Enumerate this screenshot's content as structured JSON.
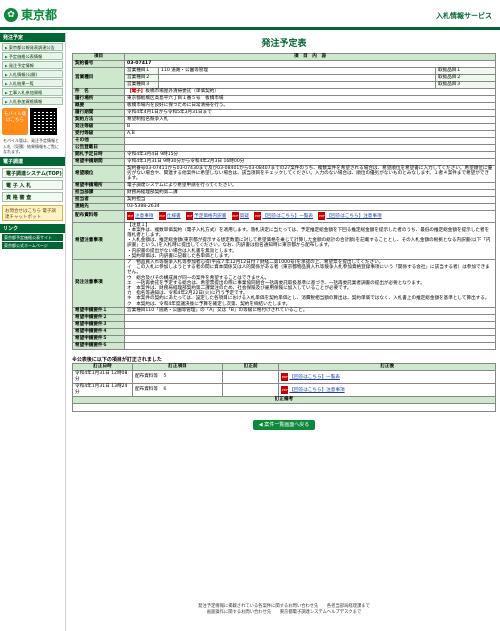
{
  "header": {
    "logo": "東京都",
    "site": "入札情報サービス"
  },
  "sidebar": {
    "section1": "発注予定",
    "links": [
      "東京都公報発表調達公告",
      "予定価格公表情報",
      "発注予定情報",
      "入札情報(公開)",
      "入札結果一覧",
      "工事入札参加資格",
      "入札参加資格情報"
    ],
    "mobile_label": "モバイル版 はこちら",
    "mobile_note": "モバイル版は、発注予定情報と入札（見積）結果情報をご覧になれます。",
    "section2": "電子調達",
    "big_links": [
      "電子調達システム(TOP)",
      "電 子 入 札",
      "資 格 審 査"
    ],
    "faq": "お問合せはこちら 電子調達チャットボット",
    "section3": "リンク",
    "ext_links": [
      "東京都予定価格公表サイト",
      "東京都公式ホームページ"
    ]
  },
  "page_title": "発注予定表",
  "cols": {
    "item": "項目",
    "content": "項　目　内　容"
  },
  "rows": {
    "contract_no_label": "契約番号",
    "contract_no": "03-07417",
    "kind_label": "営業種目",
    "kinds": [
      {
        "k": "営業種目１",
        "v": "110 道路・公園等管理",
        "c": "取扱品目１"
      },
      {
        "k": "営業種目２",
        "v": "",
        "c": "取扱品目２"
      },
      {
        "k": "営業種目３",
        "v": "",
        "c": "取扱品目３"
      }
    ],
    "name_label": "件　名",
    "name_tag": "【電子】",
    "name": "板橋市場屋外清掃委託（単価契約）",
    "place_label": "履行場所",
    "place": "東京都板橋区高島平六丁目１番５号　板橋市場",
    "summary_label": "概要",
    "summary": "板橋市場内を良好に保つために日常清掃を行う。",
    "period_label": "履行期間",
    "period": "令和4年4月1日から令和5年3月31日まで",
    "method_label": "契約方法",
    "method": "希望制指名競争入札",
    "grade_label": "発注等級",
    "grade": "B",
    "accept_label": "受付等級",
    "accept": "A,B",
    "other_label": "その他",
    "other": "",
    "publish_label": "公告登載日",
    "publish": "",
    "open_label": "開札予定日時",
    "open": "令和4年3月4日 9時15分",
    "apply_label": "希望申請期間",
    "apply": "令和4年1月31日 9時30分から令和4年2月3日 16時00分",
    "hope_label": "希望順位",
    "hope": "契約番号03-07411から03-07430まで及び03-08401から03-08407までの27案件のうち、複数案件を希望される場合は、希望順位を希望書に入力してください。希望順位に優劣がない場合や、関連する他案件に希望しない場合は、該当項目をチェックしてください。入力のない場合は、順位の優劣がないものとみなします。１者４案件まで希望ができます。",
    "sys_label": "希望申請場所",
    "sys": "電子調達システムにより希望申請を行ってください。",
    "dept_label": "担当部課",
    "dept": "財務局経理部契約第二課",
    "person_label": "担当者",
    "person": "契約担当",
    "tel_label": "連絡先",
    "tel": "03-5388-2634",
    "docs_label": "配布資料等",
    "docs": [
      "注意事項",
      "仕様書",
      "予定価格内訳書",
      "質疑",
      "【回答はこちら】一覧表",
      "【回答はこちら】注意事項"
    ],
    "notes_label": "希望注意事項",
    "notes": "【注意１】\n・本案件は、複数単価契約（電子入札方式）を適用します。落札決定に当たっては、予定推定総金額を下回る推定総金額を提示した者のうち、最低の推定総金額を提示した者を落札者とします。\n・入札金額は、推定総金額(東京都が提示する想定数量に対して希望価格を乗じて計算した金額の総計の合計額)を記載することとし、その入札金額の根拠となる内訳書(以下「内訳書」という。)を入札時に提出してください。なお、内訳書は指名通知時に東京都から配布します。\n・内訳書の提出がない場合は入札書を無効とします。\n・契約単価は、内訳書に記載した各単価とします。",
    "notes2_label": "発注注意事項",
    "notes2": "ア　物品買入れ等競争入札等参加者心得(平成７年12月12日付７財経二第1000号)を承諾の上、希望票を提出してください。\nイ　この入札に参加しようとする者の間に資本関係又は人的関係がある者（東京都物品買入れ等競争入札参加資格登録事項にいう「関係する会社」に該当する者）は参加できません。\nウ　総合及びその構成員が同一の案件を希望することはできません。\nエ　一括再委託を予定する総合は、希望票提出の際に事業協同組合一括再委託取扱基準に基づき、一括再委託業者調書の提出が必要となります。\nオ　本案件は、財務局経理部契約第二課発注のため、社会保険及び雇用保険に加入していることが必要です。\nカ　指名等通知は、令和4年2月22日(火)に行う予定です。\nキ　本案件の契約にあたっては、設定した各項目における入札単価を契約単価とし、消費税相当額の算出は、契約単価ではなく、入札書上の推定総金額を基準として算出する。\nク　本契約は、令和4年度議決後に予算を確定し次第、契約を締結いたします。",
    "extra_label": "希望申請要件",
    "extras": [
      "営業種目110「道路・公園等管理」の「A」又は「B」の等級に格付けされていること。",
      "",
      "",
      "",
      "",
      ""
    ]
  },
  "correction": {
    "title": "※公表後に以下の項目が訂正されました",
    "cols": [
      "訂正日時",
      "訂正項目",
      "訂正前",
      "訂正後"
    ],
    "rows": [
      {
        "date": "令和4年1月31日 12時08分",
        "item": "配布資料等　５",
        "before": "",
        "after": "【回答はこちら】一覧表"
      },
      {
        "date": "令和4年1月31日 13時24分",
        "item": "配布資料等　６",
        "before": "",
        "after": "【回答はこちら】注意事項"
      }
    ],
    "remark_label": "訂正備考",
    "remark": ""
  },
  "back_label": "◀ 案件一覧画面へ戻る",
  "footer": "発注予定情報に掲載されている各案件に関するお問い合わせ先　　各担当部局経理課まで\n画面操作に関するお問い合わせ先　　東京都電子調達システムヘルプデスクまで"
}
